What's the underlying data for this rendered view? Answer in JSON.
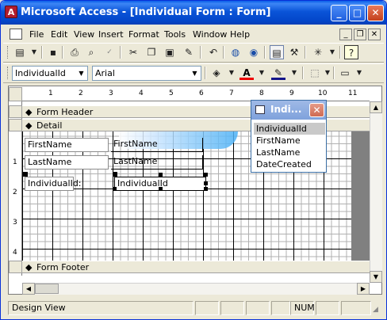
{
  "window": {
    "title": "Microsoft Access - [Individual Form : Form]",
    "app_icon_letter": "A",
    "controls": {
      "minimize": "_",
      "restore": "□",
      "close": "✕"
    }
  },
  "menubar": {
    "items": [
      "File",
      "Edit",
      "View",
      "Insert",
      "Format",
      "Tools",
      "Window",
      "Help"
    ],
    "mdi_controls": {
      "minimize": "_",
      "restore": "❐",
      "close": "✕"
    }
  },
  "formatting": {
    "object_combo": "IndividualId",
    "font_combo": "Arial"
  },
  "ruler": {
    "horizontal_ticks": [
      "1",
      "2",
      "3",
      "4",
      "5",
      "6",
      "7",
      "8",
      "9",
      "10",
      "11"
    ],
    "vertical_ticks": [
      "1",
      "2",
      "3",
      "4"
    ]
  },
  "sections": {
    "form_header": "Form Header",
    "detail": "Detail",
    "form_footer": "Form Footer"
  },
  "controls": {
    "firstname_label": "FirstName",
    "firstname_textbox": "FirstName",
    "lastname_label": "LastName",
    "lastname_textbox": "LastName",
    "individualid_label": "IndividualId:",
    "individualid_textbox": "IndividualId"
  },
  "field_list": {
    "title": "Indi...",
    "fields": [
      "IndividualId",
      "FirstName",
      "LastName",
      "DateCreated"
    ],
    "selected": "IndividualId"
  },
  "statusbar": {
    "mode": "Design View",
    "num_indicator": "NUM"
  }
}
